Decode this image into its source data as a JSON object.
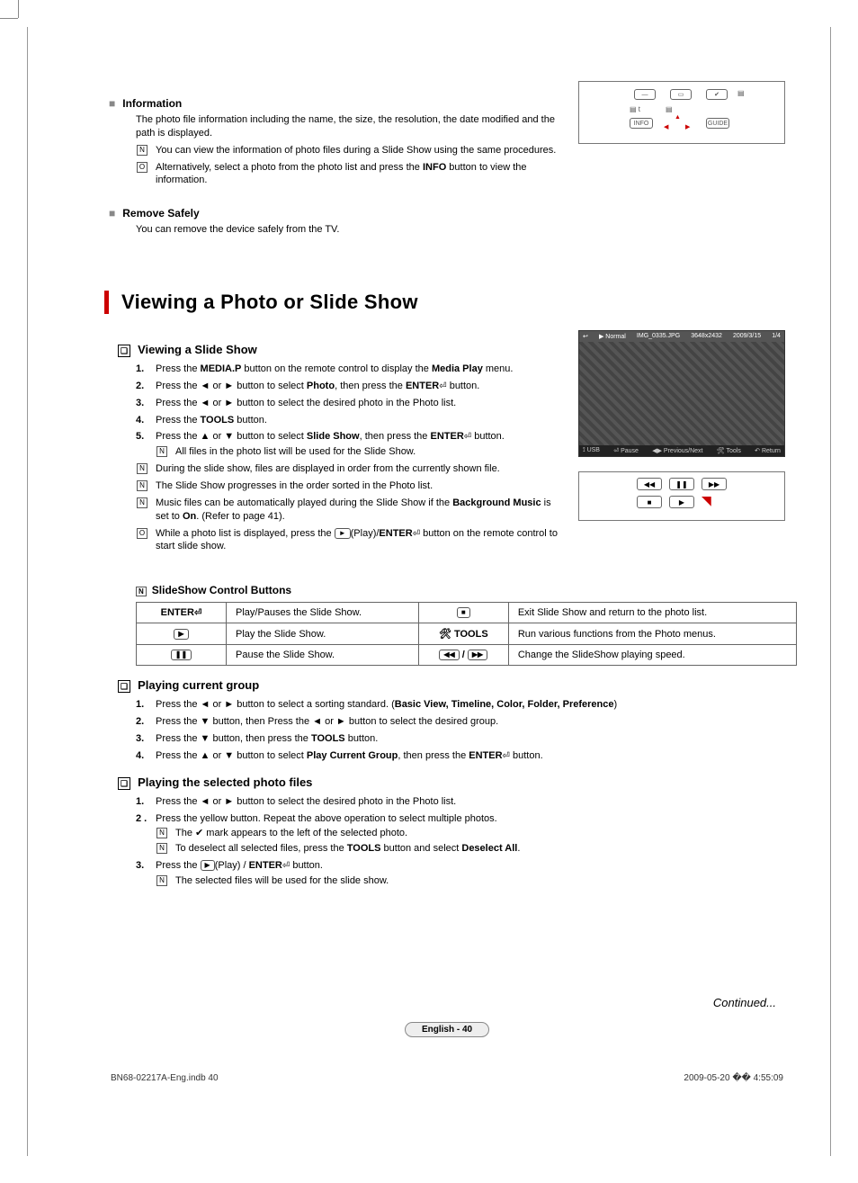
{
  "info": {
    "h": "Information",
    "desc": "The photo file information including the name, the size, the resolution, the date modified and the path is displayed.",
    "n1": "You can view the information of photo files during a Slide Show using the same procedures.",
    "n2_pre": "Alternatively, select a photo from the photo list and press the ",
    "n2_bold": "INFO",
    "n2_post": " button to view the information."
  },
  "remove": {
    "h": "Remove Safely",
    "desc": "You can remove the device safely from the TV."
  },
  "section_title": "Viewing a Photo or Slide Show",
  "slide": {
    "h": "Viewing a Slide Show",
    "s1_a": "Press the ",
    "s1_b": "MEDIA.P",
    "s1_c": " button on the remote control to display the ",
    "s1_d": "Media Play",
    "s1_e": " menu.",
    "s2_a": "Press the ◄ or ► button to select ",
    "s2_b": "Photo",
    "s2_c": ", then press the ",
    "s2_d": "ENTER",
    "s2_e": " button.",
    "s3": "Press the ◄ or ► button to select the desired photo in the Photo list.",
    "s4_a": "Press the ",
    "s4_b": "TOOLS",
    "s4_c": " button.",
    "s5_a": "Press the ▲ or ▼ button to select ",
    "s5_b": "Slide Show",
    "s5_c": ", then press the ",
    "s5_d": "ENTER",
    "s5_e": " button.",
    "s5_note": "All files in the photo list will be used for the Slide Show.",
    "n1": "During the slide show, files are displayed in order from the currently shown file.",
    "n2": "The Slide Show progresses in the order sorted in the Photo list.",
    "n3_a": "Music files can be automatically played during the Slide Show if the ",
    "n3_b": "Background Music",
    "n3_c": " is set to ",
    "n3_d": "On",
    "n3_e": ". (Refer to page 41).",
    "n4_a": "While a photo list is displayed, press the ",
    "n4_b": "(Play)/",
    "n4_c": "ENTER",
    "n4_d": " button on the remote control to start slide show."
  },
  "photo_preview": {
    "mode": "▶ Normal",
    "file": "IMG_0335.JPG",
    "res": "3648x2432",
    "date": "2009/3/15",
    "count": "1/4",
    "usb": "USB",
    "pause": "Pause",
    "prevnext": "Previous/Next",
    "tools": "Tools",
    "return": "Return"
  },
  "remote_labels": {
    "info": "INFO",
    "guide": "GUIDE"
  },
  "ctrl_table": {
    "title": "SlideShow Control Buttons",
    "r1a": "ENTER",
    "r1b": "Play/Pauses the Slide Show.",
    "r1c_desc": "Exit Slide Show and return to the photo list.",
    "r2b": "Play the Slide Show.",
    "r2c": "TOOLS",
    "r2d": "Run various functions from the Photo menus.",
    "r3b": "Pause the Slide Show.",
    "r3d": "Change the  SlideShow playing speed."
  },
  "group": {
    "h": "Playing current group",
    "s1_a": "Press the ◄ or ► button to select a sorting standard. (",
    "s1_b": "Basic View, Timeline, Color, Folder, Preference",
    "s1_c": ")",
    "s2": "Press the ▼ button, then Press the ◄ or ► button to select the desired group.",
    "s3_a": "Press the ▼ button, then press the ",
    "s3_b": "TOOLS",
    "s3_c": " button.",
    "s4_a": "Press the ▲ or ▼ button to select ",
    "s4_b": "Play Current Group",
    "s4_c": ", then press the ",
    "s4_d": "ENTER",
    "s4_e": " button."
  },
  "selected": {
    "h": "Playing the selected photo files",
    "s1": "Press the ◄ or ► button to select the desired photo in the Photo list.",
    "s2": "Press the yellow button. Repeat the above operation to select multiple photos.",
    "s2n1_a": "The ",
    "s2n1_b": " mark appears to the left of the selected photo.",
    "s2n2_a": "To deselect all selected files, press the ",
    "s2n2_b": "TOOLS",
    "s2n2_c": " button and select ",
    "s2n2_d": "Deselect All",
    "s2n2_e": ".",
    "s3_a": "Press the ",
    "s3_b": "(Play) / ",
    "s3_c": "ENTER",
    "s3_d": " button.",
    "s3n": "The selected files will be used for the slide show."
  },
  "continued": "Continued...",
  "page_lang": "English - 40",
  "footer": {
    "left": "BN68-02217A-Eng.indb   40",
    "right": "2009-05-20   �� 4:55:09"
  }
}
